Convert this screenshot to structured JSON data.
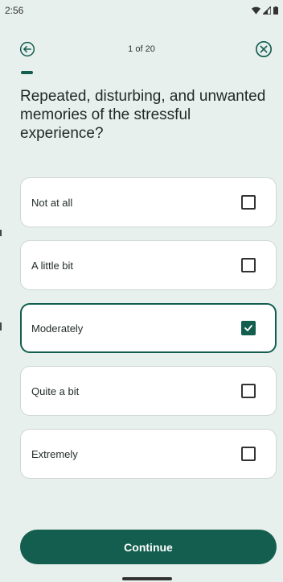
{
  "status_bar": {
    "time": "2:56",
    "icons": [
      "wifi-icon",
      "signal-icon",
      "battery-icon"
    ]
  },
  "header": {
    "progress_text": "1 of 20",
    "back_icon": "arrow-left-circle-icon",
    "close_icon": "close-circle-icon"
  },
  "progress": {
    "current": 1,
    "total": 20,
    "fraction": 0.05
  },
  "question": "Repeated, disturbing, and unwanted memories of the stressful experience?",
  "options": [
    {
      "label": "Not at all",
      "checked": false
    },
    {
      "label": "A little bit",
      "checked": false
    },
    {
      "label": "Moderately",
      "checked": true
    },
    {
      "label": "Quite a bit",
      "checked": false
    },
    {
      "label": "Extremely",
      "checked": false
    }
  ],
  "continue_label": "Continue",
  "colors": {
    "accent": "#135e4f",
    "background": "#e7f0ec",
    "card": "#ffffff"
  }
}
